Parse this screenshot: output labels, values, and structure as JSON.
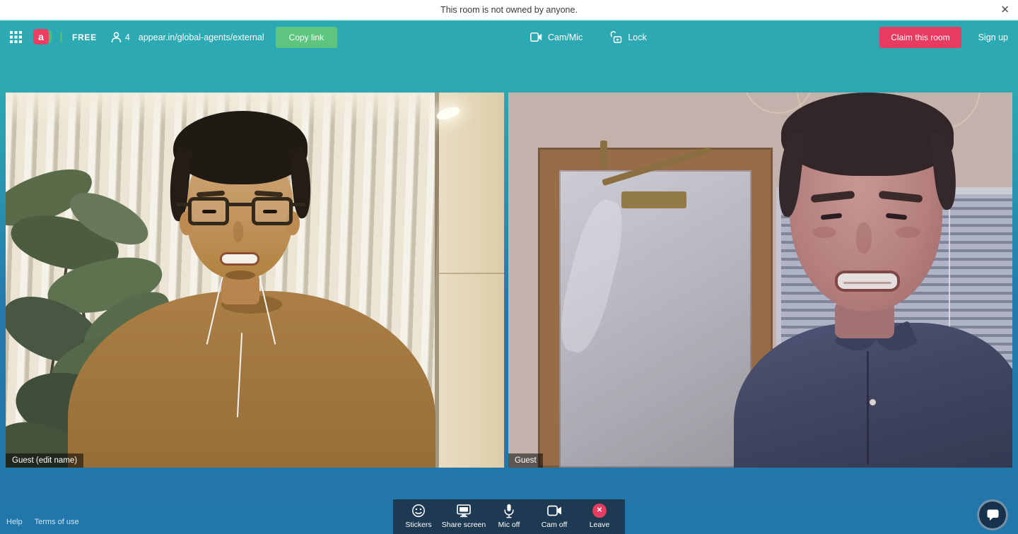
{
  "notification": {
    "text": "This room is not owned by anyone.",
    "close_glyph": "✕"
  },
  "header": {
    "logo_letter": "a",
    "plan_badge": "FREE",
    "participant_count": "4",
    "room_url": "appear.in/global-agents/external",
    "copy_link_label": "Copy link",
    "cam_mic_label": "Cam/Mic",
    "lock_label": "Lock",
    "claim_room_label": "Claim this room",
    "sign_up_label": "Sign up"
  },
  "videos": {
    "left": {
      "label": "Guest (edit name)"
    },
    "right": {
      "label": "Guest"
    }
  },
  "toolbar": {
    "items": [
      {
        "label": "Stickers",
        "icon": "smiley-icon"
      },
      {
        "label": "Share screen",
        "icon": "monitor-icon"
      },
      {
        "label": "Mic off",
        "icon": "microphone-icon"
      },
      {
        "label": "Cam off",
        "icon": "camera-icon"
      },
      {
        "label": "Leave",
        "icon": "leave-x-icon"
      }
    ],
    "leave_glyph": "✕"
  },
  "footer": {
    "help_label": "Help",
    "terms_label": "Terms of use"
  },
  "colors": {
    "teal_top": "#2CA9B2",
    "blue_bottom": "#2176AC",
    "brand_pink": "#EE3D63",
    "claim_pink": "#E73C5F",
    "green_button": "#5EC57E",
    "logo_green": "#4CBE7C",
    "toolbar_bg": "#1E3A52"
  }
}
